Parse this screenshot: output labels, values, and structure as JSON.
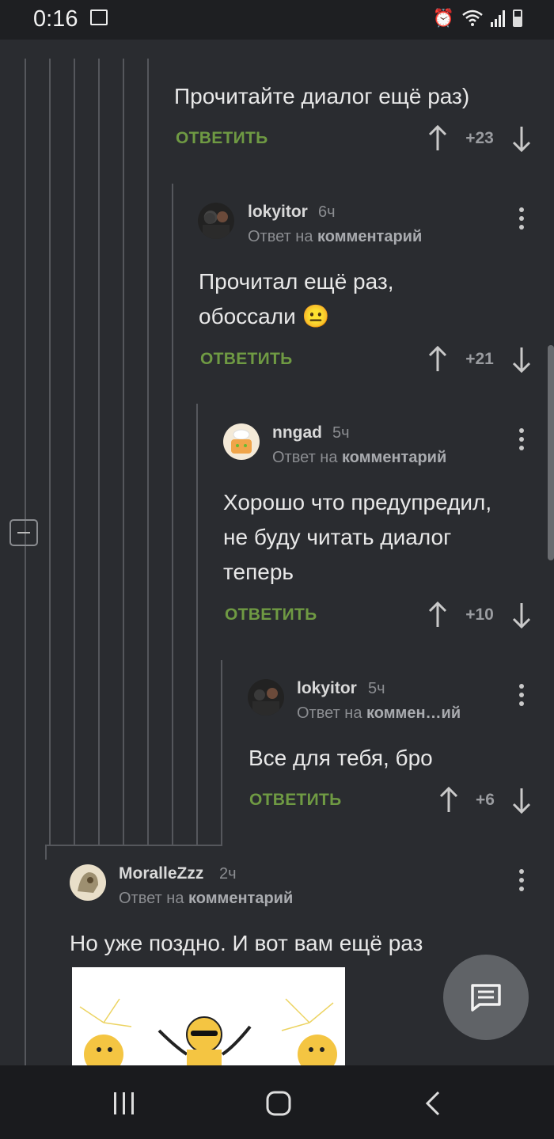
{
  "status_bar": {
    "time": "0:16"
  },
  "comments": [
    {
      "text": "Прочитайте диалог ещё раз)",
      "reply_label": "ОТВЕТИТЬ",
      "score": "+23"
    },
    {
      "username": "lokyitor",
      "time": "6ч",
      "reply_to_prefix": "Ответ на",
      "reply_to_target": "комментарий",
      "text_line1": "Прочитал ещё раз,",
      "text_line2": "обоссали",
      "emoji": "😐",
      "reply_label": "ОТВЕТИТЬ",
      "score": "+21"
    },
    {
      "username": "nngad",
      "time": "5ч",
      "reply_to_prefix": "Ответ на",
      "reply_to_target": "комментарий",
      "text_line1": "Хорошо что предупредил,",
      "text_line2": "не буду читать диалог",
      "text_line3": "теперь",
      "reply_label": "ОТВЕТИТЬ",
      "score": "+10"
    },
    {
      "username": "lokyitor",
      "time": "5ч",
      "reply_to_prefix": "Ответ на",
      "reply_to_target": "коммен…ий",
      "text": "Все для тебя, бро",
      "reply_label": "ОТВЕТИТЬ",
      "score": "+6"
    },
    {
      "username": "MoralleZzz",
      "time": "2ч",
      "reply_to_prefix": "Ответ на",
      "reply_to_target": "комментарий",
      "text": "Но уже поздно. И вот вам ещё раз"
    }
  ],
  "icons": {
    "fab": "comment-icon",
    "collapse": "collapse-icon"
  }
}
